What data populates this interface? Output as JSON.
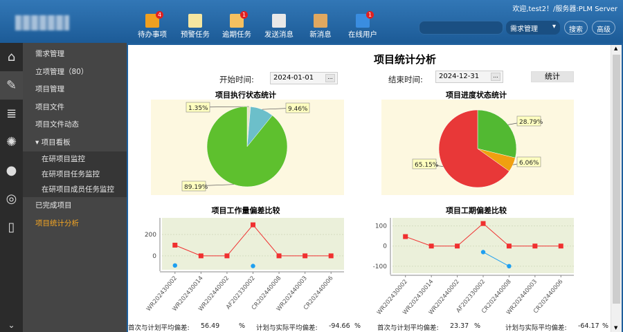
{
  "header": {
    "welcome": "欢迎,test2！/服务器:PLM Server",
    "toolbar": [
      {
        "label": "待办事项",
        "badge": "4",
        "icon": "todo-icon",
        "color": "#f0a020"
      },
      {
        "label": "预警任务",
        "badge": "",
        "icon": "warning-icon",
        "color": "#f5e6a0"
      },
      {
        "label": "逾期任务",
        "badge": "1",
        "icon": "overdue-icon",
        "color": "#f5c060"
      },
      {
        "label": "发送消息",
        "badge": "",
        "icon": "send-mail-icon",
        "color": "#e8e8e8"
      },
      {
        "label": "新消息",
        "badge": "",
        "icon": "new-message-icon",
        "color": "#e0a860"
      },
      {
        "label": "在线用户",
        "badge": "1",
        "icon": "online-users-icon",
        "color": "#3a8de0"
      }
    ],
    "search_value": "",
    "module_select": "需求管理",
    "search_btn": "搜索",
    "advanced_btn": "高级"
  },
  "sidebar": {
    "icons": [
      "home-icon",
      "edit-icon",
      "database-icon",
      "loading-icon",
      "chat-icon",
      "broadcast-icon",
      "book-icon"
    ],
    "items": [
      {
        "label": "需求管理"
      },
      {
        "label": "立项管理（80）"
      },
      {
        "label": "项目管理"
      },
      {
        "label": "项目文件"
      },
      {
        "label": "项目文件动态"
      },
      {
        "label": "▾ 项目看板"
      }
    ],
    "subitems": [
      {
        "label": "在研项目监控"
      },
      {
        "label": "在研项目任务监控"
      },
      {
        "label": "在研项目成员任务监控"
      }
    ],
    "after": [
      {
        "label": "已完成项目"
      },
      {
        "label": "项目统计分析",
        "active": true
      }
    ],
    "active_color": "#f5a623"
  },
  "page": {
    "title": "项目统计分析",
    "start_label": "开始时间:",
    "start_value": "2024-01-01",
    "end_label": "结束时间:",
    "end_value": "2024-12-31",
    "picker": "...",
    "stat_btn": "统计"
  },
  "chart_data": [
    {
      "type": "pie",
      "title": "项目执行状态统计",
      "slices": [
        {
          "label": "1.35%",
          "value": 1.35,
          "color": "#e8e4c8"
        },
        {
          "label": "9.46%",
          "value": 9.46,
          "color": "#6cbfca"
        },
        {
          "label": "89.19%",
          "value": 89.19,
          "color": "#5ec02e"
        }
      ]
    },
    {
      "type": "pie",
      "title": "项目进度状态统计",
      "slices": [
        {
          "label": "28.79%",
          "value": 28.79,
          "color": "#52b932"
        },
        {
          "label": "6.06%",
          "value": 6.06,
          "color": "#f0a010"
        },
        {
          "label": "65.15%",
          "value": 65.15,
          "color": "#e83838"
        }
      ]
    },
    {
      "type": "line",
      "title": "项目工作量偏差比较",
      "categories": [
        "WR202430002",
        "WR202430014",
        "WR202440002",
        "AF202330002",
        "CR202440008",
        "WR202440003",
        "CR202440006"
      ],
      "yticks": [
        0,
        200
      ],
      "ylim": [
        -130,
        355
      ],
      "series": [
        {
          "color": "#f03030",
          "values": [
            100,
            0,
            0,
            290,
            0,
            0,
            0
          ]
        },
        {
          "color": "#1e9ff0",
          "values": [
            -90,
            null,
            null,
            -95,
            null,
            null,
            null
          ]
        }
      ]
    },
    {
      "type": "line",
      "title": "项目工期偏差比较",
      "categories": [
        "WR202430002",
        "WR202430014",
        "WR202440002",
        "AF202330002",
        "CR202440008",
        "WR202440003",
        "CR202440006"
      ],
      "yticks": [
        -100,
        0,
        100
      ],
      "ylim": [
        -135,
        140
      ],
      "series": [
        {
          "color": "#f03030",
          "values": [
            47,
            0,
            0,
            112,
            0,
            0,
            0
          ]
        },
        {
          "color": "#1e9ff0",
          "values": [
            null,
            null,
            null,
            -30,
            -100,
            null,
            null
          ]
        }
      ]
    }
  ],
  "footer": [
    {
      "label": "首次与计划平均偏差:",
      "value": "56.49",
      "unit": "%"
    },
    {
      "label": "计划与实际平均偏差:",
      "value": "-94.66",
      "unit": "%"
    },
    {
      "label": "首次与计划平均偏差:",
      "value": "23.37",
      "unit": "%"
    },
    {
      "label": "计划与实际平均偏差:",
      "value": "-64.17",
      "unit": "%"
    }
  ]
}
